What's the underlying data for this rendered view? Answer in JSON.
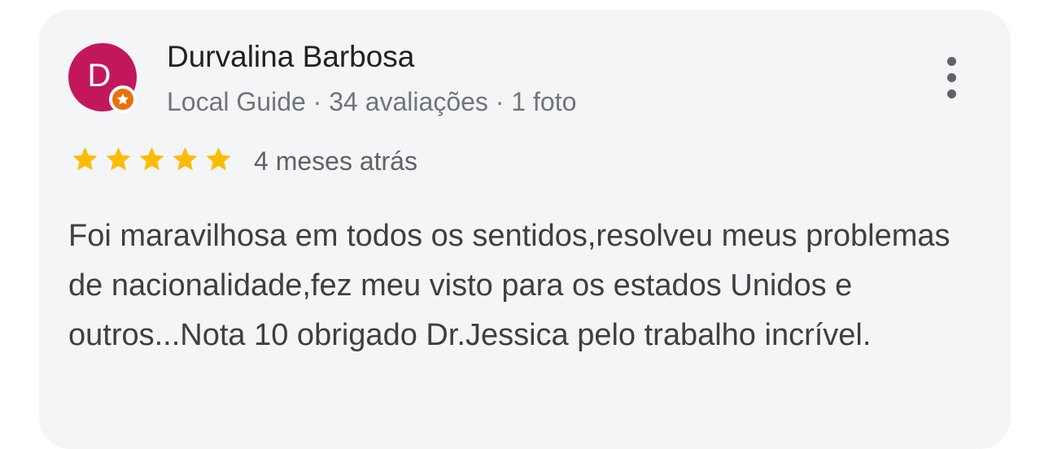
{
  "review": {
    "author_initial": "D",
    "author_name": "Durvalina Barbosa",
    "author_meta": "Local Guide · 34 avaliações · 1 foto",
    "rating": 5,
    "rating_max": 5,
    "date": "4 meses atrás",
    "text": "Foi maravilhosa em todos os sentidos,resolveu meus problemas de nacionalidade,fez meu visto para os estados Unidos e outros...Nota 10 obrigado Dr.Jessica pelo trabalho incrível."
  },
  "colors": {
    "avatar": "#c2185b",
    "guide_badge": "#e8710a",
    "star": "#fbbc04",
    "card_background": "#f4f5f7"
  },
  "icons": {
    "badge": "local-guide-star-icon",
    "menu": "more-vertical-icon",
    "rating": "star-icon"
  }
}
